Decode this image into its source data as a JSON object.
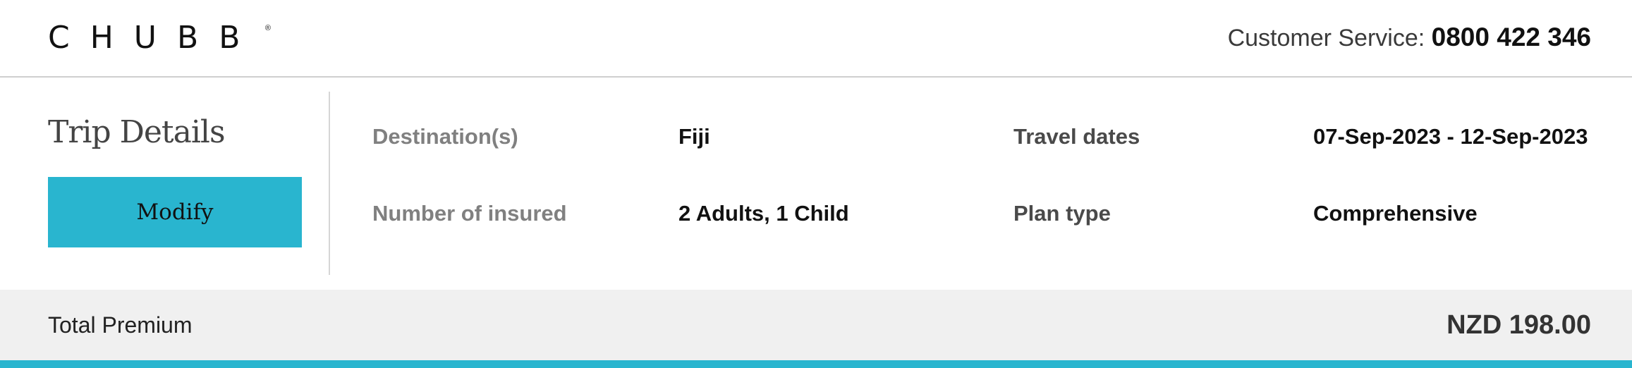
{
  "header": {
    "logo_text": "CHUBB",
    "logo_reg": "®",
    "customer_service_label": "Customer Service:",
    "customer_service_phone": "0800 422 346"
  },
  "trip": {
    "title": "Trip Details",
    "modify_label": "Modify",
    "fields": {
      "destination_label": "Destination(s)",
      "destination_value": "Fiji",
      "travel_dates_label": "Travel dates",
      "travel_dates_value": "07-Sep-2023 - 12-Sep-2023",
      "insured_label": "Number of insured",
      "insured_value": "2 Adults, 1 Child",
      "plan_type_label": "Plan type",
      "plan_type_value": "Comprehensive"
    }
  },
  "premium": {
    "label": "Total Premium",
    "value": "NZD 198.00"
  },
  "colors": {
    "accent": "#29b5cf",
    "premium_bg": "#f0f0f0"
  }
}
